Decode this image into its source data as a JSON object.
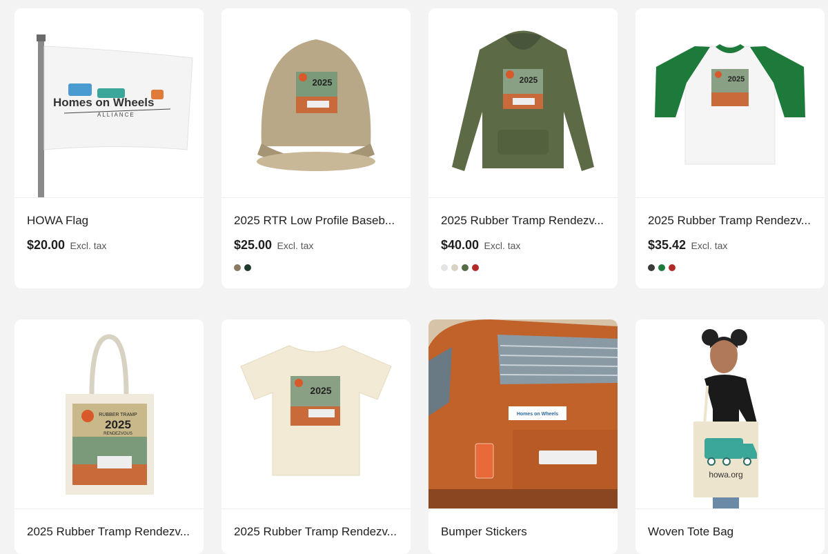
{
  "products": [
    {
      "title": "HOWA Flag",
      "price": "$20.00",
      "tax": "Excl. tax",
      "swatches": [],
      "image": "flag-image"
    },
    {
      "title": "2025 RTR Low Profile Baseb...",
      "price": "$25.00",
      "tax": "Excl. tax",
      "swatches": [
        "#8a7a64",
        "#1f3b2c"
      ],
      "image": "cap-image"
    },
    {
      "title": "2025 Rubber Tramp Rendezv...",
      "price": "$40.00",
      "tax": "Excl. tax",
      "swatches": [
        "#e4e4e4",
        "#d8d2c2",
        "#556b45",
        "#b02a2a"
      ],
      "image": "hoodie-image"
    },
    {
      "title": "2025 Rubber Tramp Rendezv...",
      "price": "$35.42",
      "tax": "Excl. tax",
      "swatches": [
        "#3a3a3a",
        "#1e7a3a",
        "#b02a2a"
      ],
      "image": "raglan-image"
    },
    {
      "title": "2025 Rubber Tramp Rendezv...",
      "image": "tote-image"
    },
    {
      "title": "2025 Rubber Tramp Rendezv...",
      "image": "tshirt-image"
    },
    {
      "title": "Bumper Stickers",
      "image": "van-image"
    },
    {
      "title": "Woven Tote Bag",
      "image": "woven-tote-image"
    }
  ],
  "logos": {
    "flag_line1": "Homes on Wheels",
    "flag_line2": "ALLIANCE",
    "design_year": "2025",
    "design_text": "RUBBER TRAMP",
    "design_text2": "RENDEZVOUS",
    "tote_url": "howa.org"
  },
  "colors": {
    "accent_teal": "#3aa79a",
    "accent_orange": "#e07a3a"
  }
}
